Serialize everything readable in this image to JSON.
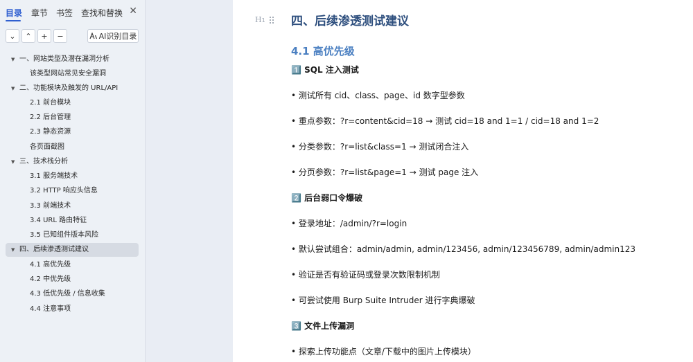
{
  "sidebar": {
    "tabs": [
      {
        "label": "目录",
        "active": true
      },
      {
        "label": "章节"
      },
      {
        "label": "书签"
      },
      {
        "label": "查找和替换"
      }
    ],
    "close_glyph": "✕",
    "toolbar": {
      "collapse_glyph": "⌄",
      "expand_glyph": "⌃",
      "add_glyph": "+",
      "remove_glyph": "−",
      "ai_label": "AI识别目录"
    },
    "toc": [
      {
        "label": "一、网站类型及潜在漏洞分析",
        "level": 1,
        "expanded": true
      },
      {
        "label": "该类型网站常见安全漏洞",
        "level": 2
      },
      {
        "label": "二、功能模块及触发的 URL/API",
        "level": 1,
        "expanded": true
      },
      {
        "label": "2.1 前台模块",
        "level": 2
      },
      {
        "label": "2.2 后台管理",
        "level": 2
      },
      {
        "label": "2.3 静态资源",
        "level": 2
      },
      {
        "label": "各页面截图",
        "level": 2
      },
      {
        "label": "三、技术栈分析",
        "level": 1,
        "expanded": true
      },
      {
        "label": "3.1 服务端技术",
        "level": 2
      },
      {
        "label": "3.2 HTTP 响应头信息",
        "level": 2
      },
      {
        "label": "3.3 前端技术",
        "level": 2
      },
      {
        "label": "3.4 URL 路由特征",
        "level": 2
      },
      {
        "label": "3.5 已知组件版本风险",
        "level": 2
      },
      {
        "label": "四、后续渗透测试建议",
        "level": 1,
        "expanded": true,
        "selected": true
      },
      {
        "label": "4.1 高优先级",
        "level": 2
      },
      {
        "label": "4.2 中优先级",
        "level": 2
      },
      {
        "label": "4.3 低优先级 / 信息收集",
        "level": 2
      },
      {
        "label": "4.4 注意事项",
        "level": 2
      }
    ]
  },
  "document": {
    "heading_handle": "H",
    "h1": "四、后续渗透测试建议",
    "h2": "4.1 高优先级",
    "sections": [
      {
        "title": "1️⃣ SQL 注入测试",
        "items": [
          "• 测试所有 cid、class、page、id 数字型参数",
          "• 重点参数：?r=content&cid=18 → 测试 cid=18 and 1=1 / cid=18 and 1=2",
          "• 分类参数：?r=list&class=1 → 测试闭合注入",
          "• 分页参数：?r=list&page=1 → 测试 page 注入"
        ]
      },
      {
        "title": "2️⃣ 后台弱口令爆破",
        "items": [
          "• 登录地址：/admin/?r=login",
          "• 默认尝试组合：admin/admin, admin/123456, admin/123456789, admin/admin123",
          "• 验证是否有验证码或登录次数限制机制",
          "• 可尝试使用 Burp Suite Intruder 进行字典爆破"
        ]
      },
      {
        "title": "3️⃣ 文件上传漏洞",
        "items": [
          "• 探索上传功能点（文章/下载中的图片上传模块）"
        ]
      }
    ]
  },
  "colors": {
    "accent": "#2f5fd0",
    "h1": "#2e4f7e",
    "h2": "#4a7fc1"
  }
}
